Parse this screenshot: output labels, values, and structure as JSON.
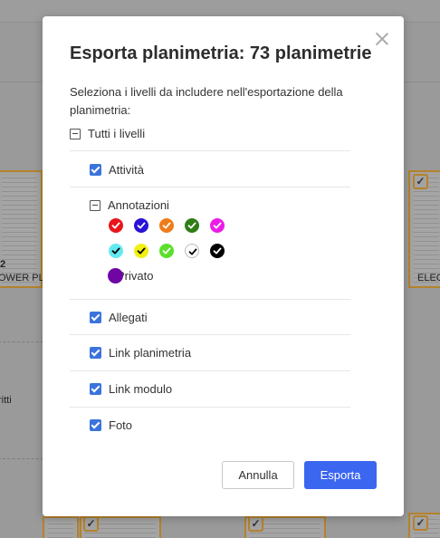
{
  "background": {
    "cards": [
      {
        "label": "2",
        "sublabel": "OWER PL"
      },
      {
        "label": "",
        "sublabel": "ELEC"
      }
    ],
    "side_text": "ritti"
  },
  "modal": {
    "title": "Esporta planimetria: 73 planimetrie",
    "description": "Seleziona i livelli da includere nell'esportazione della planimetria:",
    "all_layers_label": "Tutti i livelli",
    "layers": {
      "activities": "Attività",
      "annotations": "Annotazioni",
      "private": "Privato",
      "attachments": "Allegati",
      "plan_links": "Link planimetria",
      "form_links": "Link modulo",
      "photos": "Foto"
    },
    "annotation_colors_row1": [
      "#e8141c",
      "#2a12d6",
      "#ef7c1a",
      "#2f7d17",
      "#eb1ce6"
    ],
    "annotation_colors_row2": [
      "#63e9f2",
      "#f2ef12",
      "#5be02b",
      "#ffffff",
      "#000000"
    ],
    "private_color": "#6f05a3",
    "accent_color": "#3b73dc",
    "buttons": {
      "cancel": "Annulla",
      "export": "Esporta"
    }
  }
}
